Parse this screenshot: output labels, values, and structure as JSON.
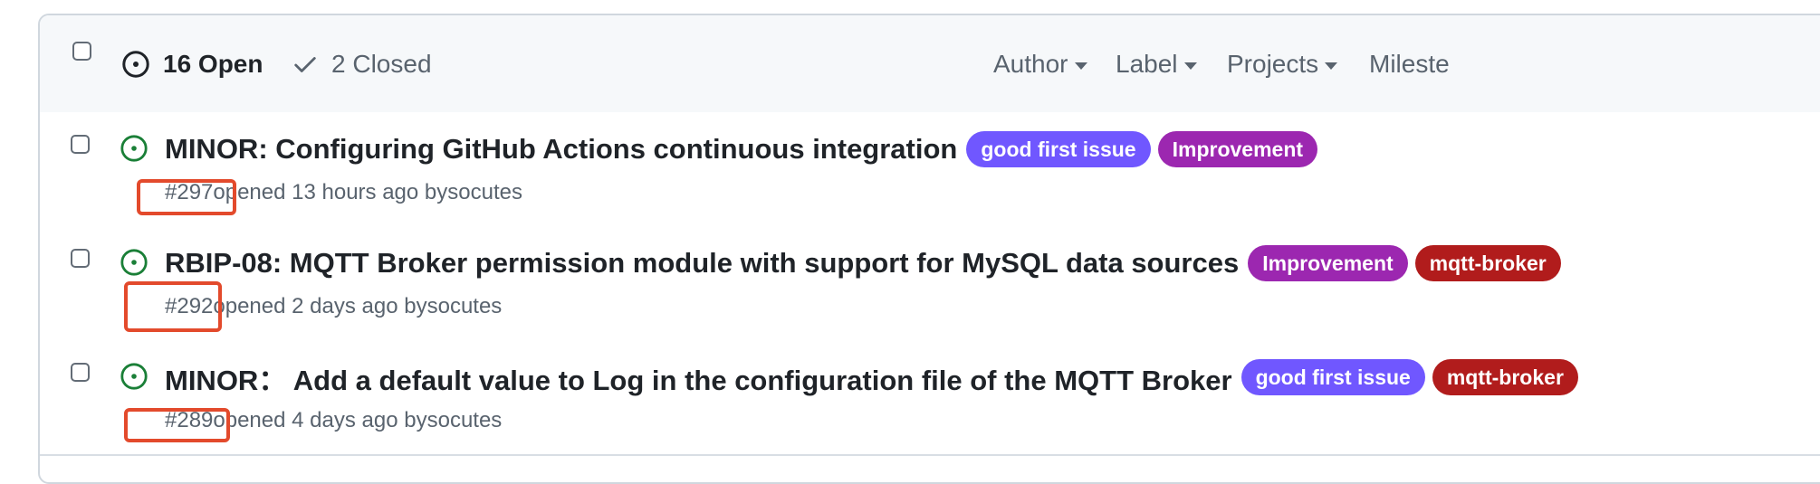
{
  "header": {
    "open_count_label": "16 Open",
    "closed_count_label": "2 Closed",
    "filters": [
      {
        "label": "Author"
      },
      {
        "label": "Label"
      },
      {
        "label": "Projects"
      },
      {
        "label": "Mileste"
      }
    ]
  },
  "issues": [
    {
      "title": "MINOR: Configuring GitHub Actions continuous integration",
      "number": "#297",
      "opened_text": " opened 13 hours ago by ",
      "author": "socutes",
      "labels": [
        {
          "name": "good first issue",
          "color": "#7057ff"
        },
        {
          "name": "Improvement",
          "color": "#9c27b0"
        }
      ]
    },
    {
      "title": "RBIP-08: MQTT Broker permission module with support for MySQL data sources",
      "number": "#292",
      "opened_text": " opened 2 days ago by ",
      "author": "socutes",
      "labels": [
        {
          "name": "Improvement",
          "color": "#9c27b0"
        },
        {
          "name": "mqtt-broker",
          "color": "#b11c1c"
        }
      ]
    },
    {
      "title": "MINOR： Add a default value to Log in the configuration file of the MQTT Broker",
      "number": "#289",
      "opened_text": " opened 4 days ago by ",
      "author": "socutes",
      "labels": [
        {
          "name": "good first issue",
          "color": "#7057ff"
        },
        {
          "name": "mqtt-broker",
          "color": "#b11c1c"
        }
      ]
    }
  ],
  "colors": {
    "open_icon": "#1a7f37",
    "highlight": "#e34a2c"
  },
  "icons": {
    "open_tab": "issue-opened-icon",
    "closed_tab": "check-icon",
    "row_status": "issue-opened-icon"
  }
}
